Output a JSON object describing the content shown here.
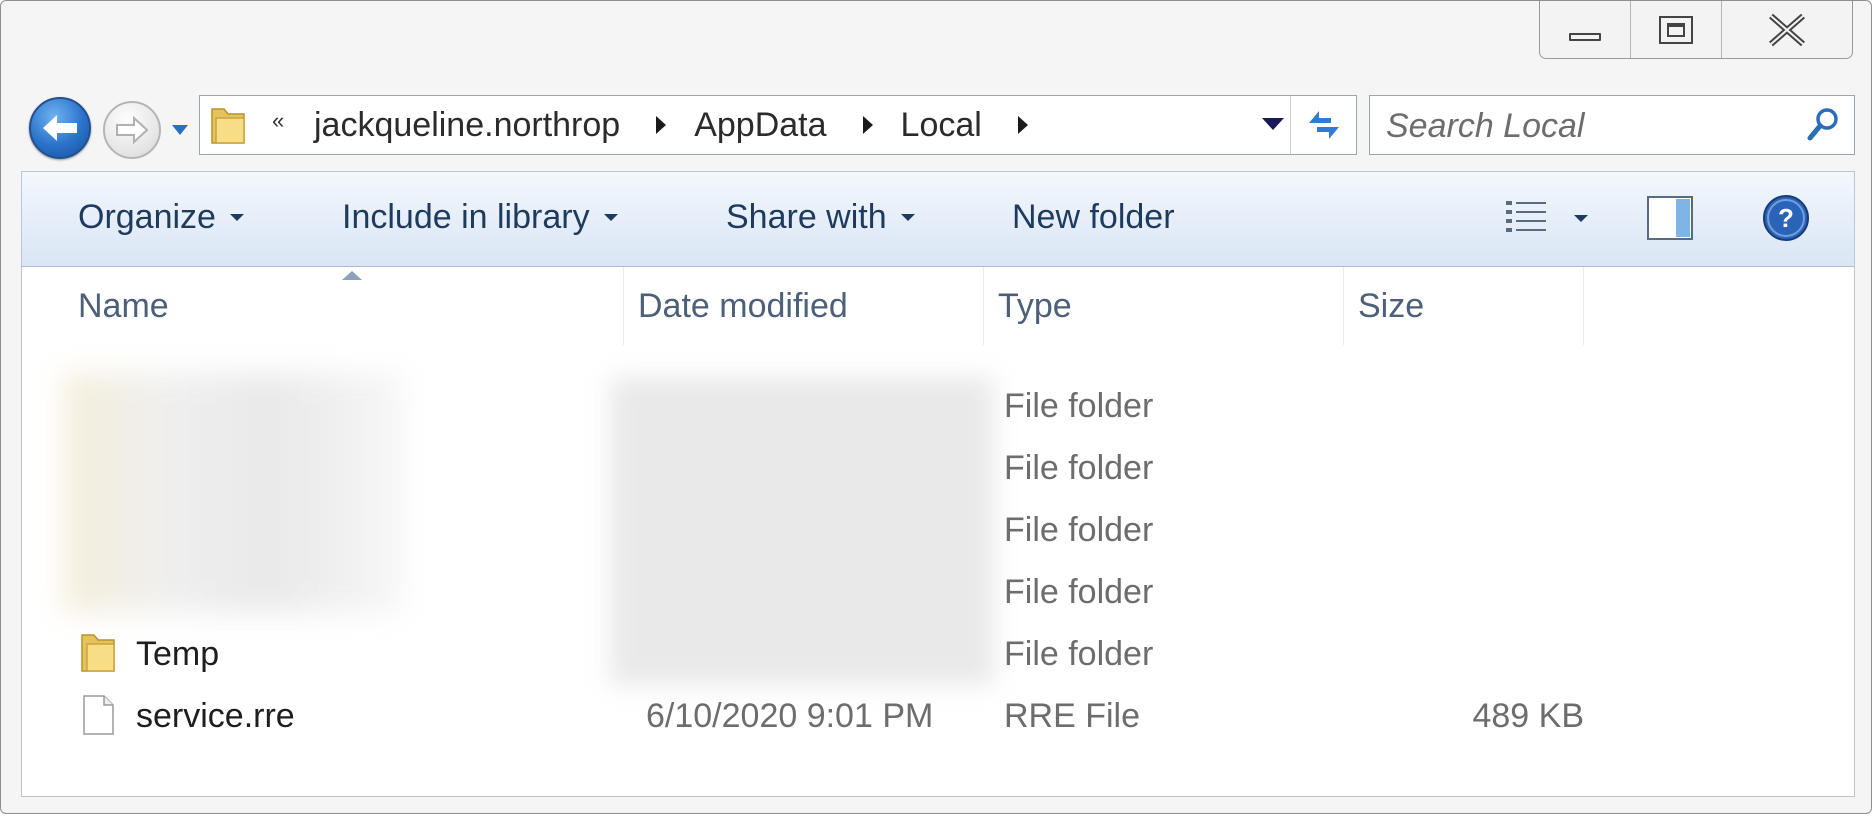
{
  "window": {
    "controls": {
      "minimize_icon": "minimize-icon",
      "maximize_icon": "maximize-icon",
      "close_icon": "close-icon"
    }
  },
  "navigation": {
    "back_icon": "back-arrow-icon",
    "forward_icon": "forward-arrow-icon",
    "recent_icon": "chevron-down-icon"
  },
  "address_bar": {
    "overflow": "«",
    "breadcrumbs": [
      "jackqueline.northrop",
      "AppData",
      "Local"
    ]
  },
  "search": {
    "placeholder": "Search Local"
  },
  "toolbar": {
    "organize": "Organize",
    "include_in_library": "Include in library",
    "share_with": "Share with",
    "new_folder": "New folder",
    "views_icon": "details-view-icon",
    "preview_icon": "preview-pane-icon",
    "help_icon": "help-icon"
  },
  "columns": {
    "name": "Name",
    "date_modified": "Date modified",
    "type": "Type",
    "size": "Size"
  },
  "files": [
    {
      "name": "",
      "date": "",
      "type": "File folder",
      "size": "",
      "redacted": true
    },
    {
      "name": "",
      "date": "",
      "type": "File folder",
      "size": "",
      "redacted": true
    },
    {
      "name": "",
      "date": "",
      "type": "File folder",
      "size": "",
      "redacted": true
    },
    {
      "name": "",
      "date": "",
      "type": "File folder",
      "size": "",
      "redacted": true
    },
    {
      "name": "Temp",
      "date": "",
      "type": "File folder",
      "size": "",
      "icon": "folder-icon"
    },
    {
      "name": "service.rre",
      "date": "6/10/2020 9:01 PM",
      "type": "RRE File",
      "size": "489 KB",
      "icon": "file-icon"
    }
  ]
}
